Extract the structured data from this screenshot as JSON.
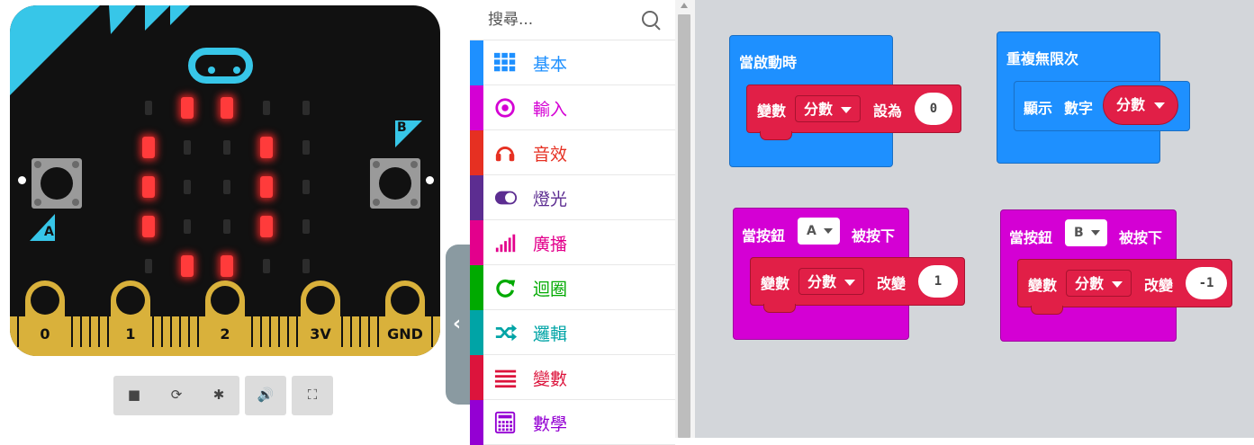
{
  "simulator": {
    "pins": [
      "0",
      "1",
      "2",
      "3V",
      "GND"
    ],
    "button_a_label": "A",
    "button_b_label": "B",
    "led_matrix": [
      [
        0,
        1,
        1,
        0,
        0
      ],
      [
        1,
        0,
        0,
        1,
        0
      ],
      [
        1,
        0,
        0,
        1,
        0
      ],
      [
        1,
        0,
        0,
        1,
        0
      ],
      [
        0,
        1,
        1,
        0,
        0
      ]
    ],
    "toolbar_icons": [
      "stop-icon",
      "restart-icon",
      "debug-icon",
      "mute-icon",
      "fullscreen-icon"
    ]
  },
  "toolbox": {
    "search_placeholder": "搜尋...",
    "categories": [
      {
        "label": "基本",
        "color": "#1e90ff",
        "icon": "grid-icon"
      },
      {
        "label": "輸入",
        "color": "#d400d4",
        "icon": "target-icon"
      },
      {
        "label": "音效",
        "color": "#e63022",
        "icon": "headphones-icon"
      },
      {
        "label": "燈光",
        "color": "#5c2d91",
        "icon": "toggle-icon"
      },
      {
        "label": "廣播",
        "color": "#e3008c",
        "icon": "signal-icon"
      },
      {
        "label": "迴圈",
        "color": "#00aa00",
        "icon": "loop-icon"
      },
      {
        "label": "邏輯",
        "color": "#00a4a6",
        "icon": "shuffle-icon"
      },
      {
        "label": "變數",
        "color": "#dc143c",
        "icon": "lines-icon"
      },
      {
        "label": "數學",
        "color": "#9400d3",
        "icon": "calculator-icon"
      }
    ]
  },
  "workspace": {
    "on_start": {
      "title": "當啟動時",
      "stmt_var_kw": "變數",
      "var_name": "分數",
      "set_kw": "設為",
      "value": "0",
      "color": "#1e90ff"
    },
    "forever": {
      "title": "重複無限次",
      "show_kw": "顯示",
      "number_kw": "數字",
      "var_name": "分數",
      "color": "#1e90ff"
    },
    "button_a": {
      "title_prefix": "當按鈕",
      "button": "A",
      "title_suffix": "被按下",
      "stmt_var_kw": "變數",
      "var_name": "分數",
      "change_kw": "改變",
      "value": "1",
      "color": "#d400d4"
    },
    "button_b": {
      "title_prefix": "當按鈕",
      "button": "B",
      "title_suffix": "被按下",
      "stmt_var_kw": "變數",
      "var_name": "分數",
      "change_kw": "改變",
      "value": "-1",
      "color": "#d400d4"
    }
  }
}
